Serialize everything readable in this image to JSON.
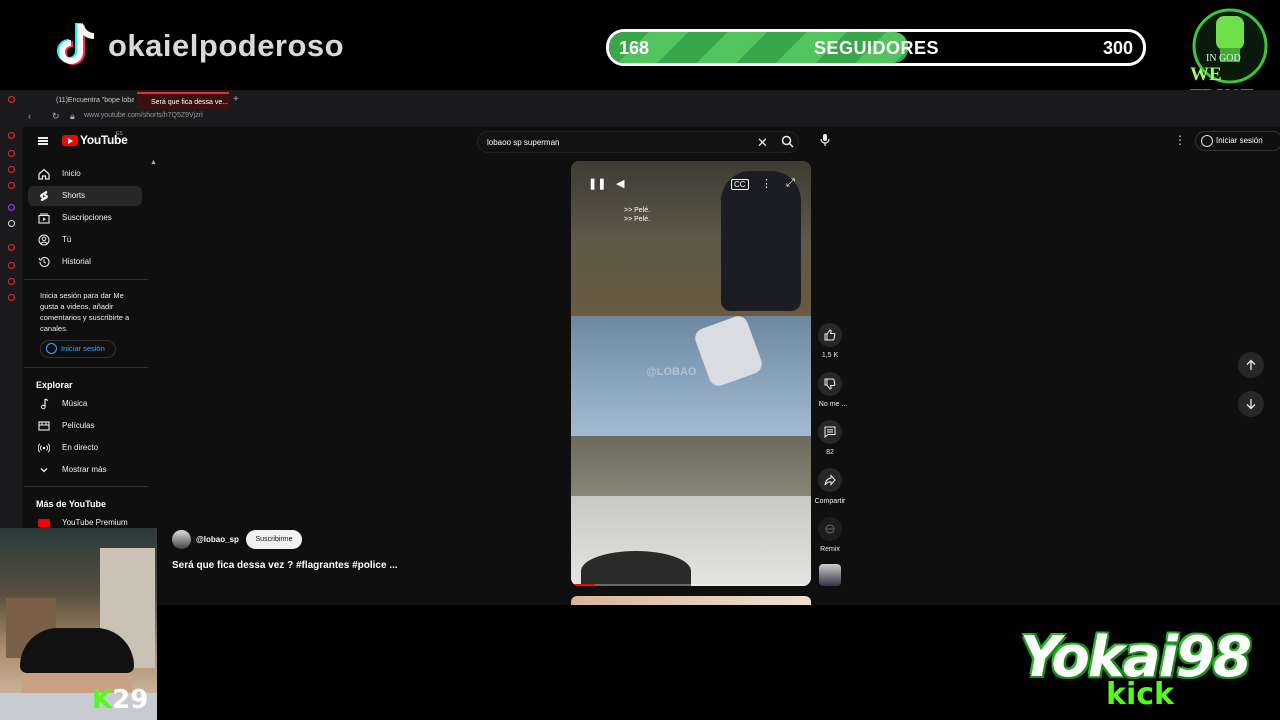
{
  "overlay": {
    "channel_name": "okaielpoderoso",
    "goal": {
      "current": "168",
      "label": "SEGUIDORES",
      "max": "300",
      "progress": 0.56
    },
    "badge": {
      "line1": "IN GOD",
      "line2": "WE TRUST"
    },
    "kick_badge": {
      "k": "K",
      "number": "29"
    },
    "brand": {
      "name": "Yokai98",
      "sub": "kick"
    },
    "colors": {
      "goal_green": "#3aa64a",
      "kick_green": "#53fc18"
    }
  },
  "browser": {
    "tabs": [
      {
        "label": "(11)Encuentra \"bope lobao..."
      },
      {
        "label": "Será que fica dessa ve..."
      }
    ],
    "url": "www.youtube.com/shorts/h7Q5Z9Vjzrl"
  },
  "youtube": {
    "logo": "YouTube",
    "logo_country": "ES",
    "search": {
      "value": "lobaoo sp superman"
    },
    "signin_label": "Iniciar sesión",
    "sidebar": {
      "items": [
        {
          "label": "Inicio",
          "icon": "home-icon"
        },
        {
          "label": "Shorts",
          "icon": "shorts-icon"
        },
        {
          "label": "Suscripciones",
          "icon": "subscriptions-icon"
        },
        {
          "label": "Tú",
          "icon": "you-icon"
        },
        {
          "label": "Historial",
          "icon": "history-icon"
        }
      ],
      "signin_message": "Inicia sesión para dar Me gusta a videos, añadir comentarios y suscribirte a canales.",
      "signin_button": "Iniciar sesión",
      "explore_title": "Explorar",
      "explore_items": [
        {
          "label": "Música"
        },
        {
          "label": "Películas"
        },
        {
          "label": "En directo"
        },
        {
          "label": "Mostrar más"
        }
      ],
      "more_title": "Más de YouTube",
      "more_items": [
        {
          "label": "YouTube Premium"
        }
      ]
    },
    "short": {
      "subtitles": [
        ">> Pelé.",
        ">> Pelé."
      ],
      "watermark": "@LOBAO",
      "progress": 0.1,
      "likes": "1,5 K",
      "dislike_label": "No me ...",
      "comments": "82",
      "share_label": "Compartir",
      "remix_label": "Remix",
      "channel": "@lobao_sp",
      "subscribe_label": "Suscribirme",
      "title": "Será que fica dessa vez ? #flagrantes #police ..."
    }
  }
}
